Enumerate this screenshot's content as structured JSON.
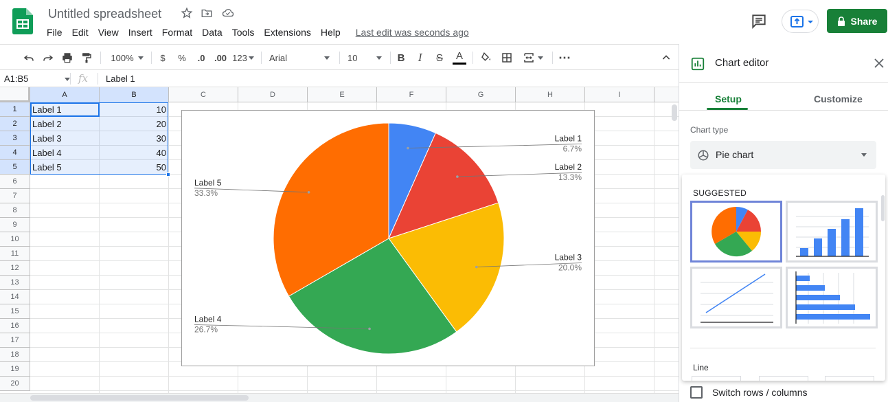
{
  "header": {
    "title": "Untitled spreadsheet",
    "menu": [
      "File",
      "Edit",
      "View",
      "Insert",
      "Format",
      "Data",
      "Tools",
      "Extensions",
      "Help"
    ],
    "last_edit": "Last edit was seconds ago",
    "share_label": "Share",
    "brand_color": "#188038"
  },
  "toolbar": {
    "zoom": "100%",
    "currency": "$",
    "percent": "%",
    "decrease_decimal": ".0",
    "increase_decimal": ".00",
    "format_more": "123",
    "font": "Arial",
    "font_size": "10",
    "bold": "B",
    "italic": "I",
    "strike": "S",
    "text_color": "A",
    "more": "⋯"
  },
  "formula_bar": {
    "name_box": "A1:B5",
    "fx": "fx",
    "value": "Label 1"
  },
  "grid": {
    "columns": [
      "A",
      "B",
      "C",
      "D",
      "E",
      "F",
      "G",
      "H",
      "I"
    ],
    "rows": [
      "1",
      "2",
      "3",
      "4",
      "5",
      "6",
      "7",
      "8",
      "9",
      "10",
      "11",
      "12",
      "13",
      "14",
      "15",
      "16",
      "17",
      "18",
      "19",
      "20"
    ],
    "data": [
      {
        "label": "Label 1",
        "value": "10"
      },
      {
        "label": "Label 2",
        "value": "20"
      },
      {
        "label": "Label 3",
        "value": "30"
      },
      {
        "label": "Label 4",
        "value": "40"
      },
      {
        "label": "Label 5",
        "value": "50"
      }
    ]
  },
  "chart_data": {
    "type": "pie",
    "categories": [
      "Label 1",
      "Label 2",
      "Label 3",
      "Label 4",
      "Label 5"
    ],
    "values": [
      10,
      20,
      30,
      40,
      50
    ],
    "percent_labels": [
      "6.7%",
      "13.3%",
      "20.0%",
      "26.7%",
      "33.3%"
    ],
    "colors": [
      "#4285f4",
      "#ea4335",
      "#fbbc04",
      "#34a853",
      "#ff6d01"
    ],
    "title": "",
    "legend": "labeled"
  },
  "editor": {
    "title": "Chart editor",
    "tabs": [
      "Setup",
      "Customize"
    ],
    "chart_type_label": "Chart type",
    "chart_type_value": "Pie chart",
    "suggested_label": "SUGGESTED",
    "line_label": "Line",
    "switch_label": "Switch rows / columns"
  }
}
